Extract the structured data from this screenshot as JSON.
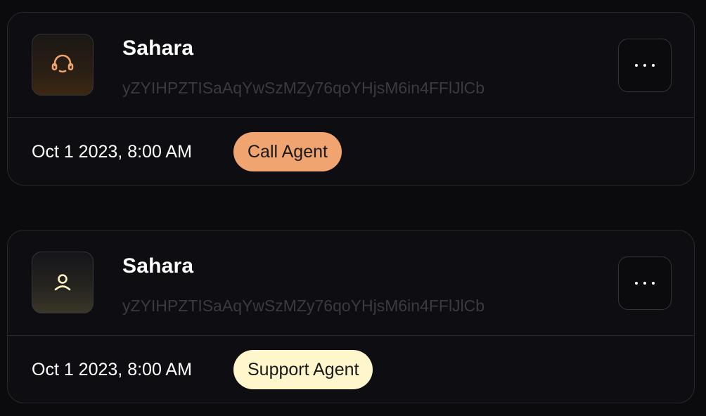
{
  "cards": [
    {
      "name": "Sahara",
      "key": "yZYIHPZTISaAqYwSzMZy76qoYHjsM6in4FFlJlCb",
      "date": "Oct 1 2023, 8:00 AM",
      "badge": "Call Agent",
      "badge_color": "#f0a46f",
      "icon": "headset-icon",
      "icon_color": "#f0a46f"
    },
    {
      "name": "Sahara",
      "key": "yZYIHPZTISaAqYwSzMZy76qoYHjsM6in4FFlJlCb",
      "date": "Oct 1 2023, 8:00 AM",
      "badge": "Support Agent",
      "badge_color": "#fff6cc",
      "icon": "user-icon",
      "icon_color": "#fff3c4"
    }
  ]
}
